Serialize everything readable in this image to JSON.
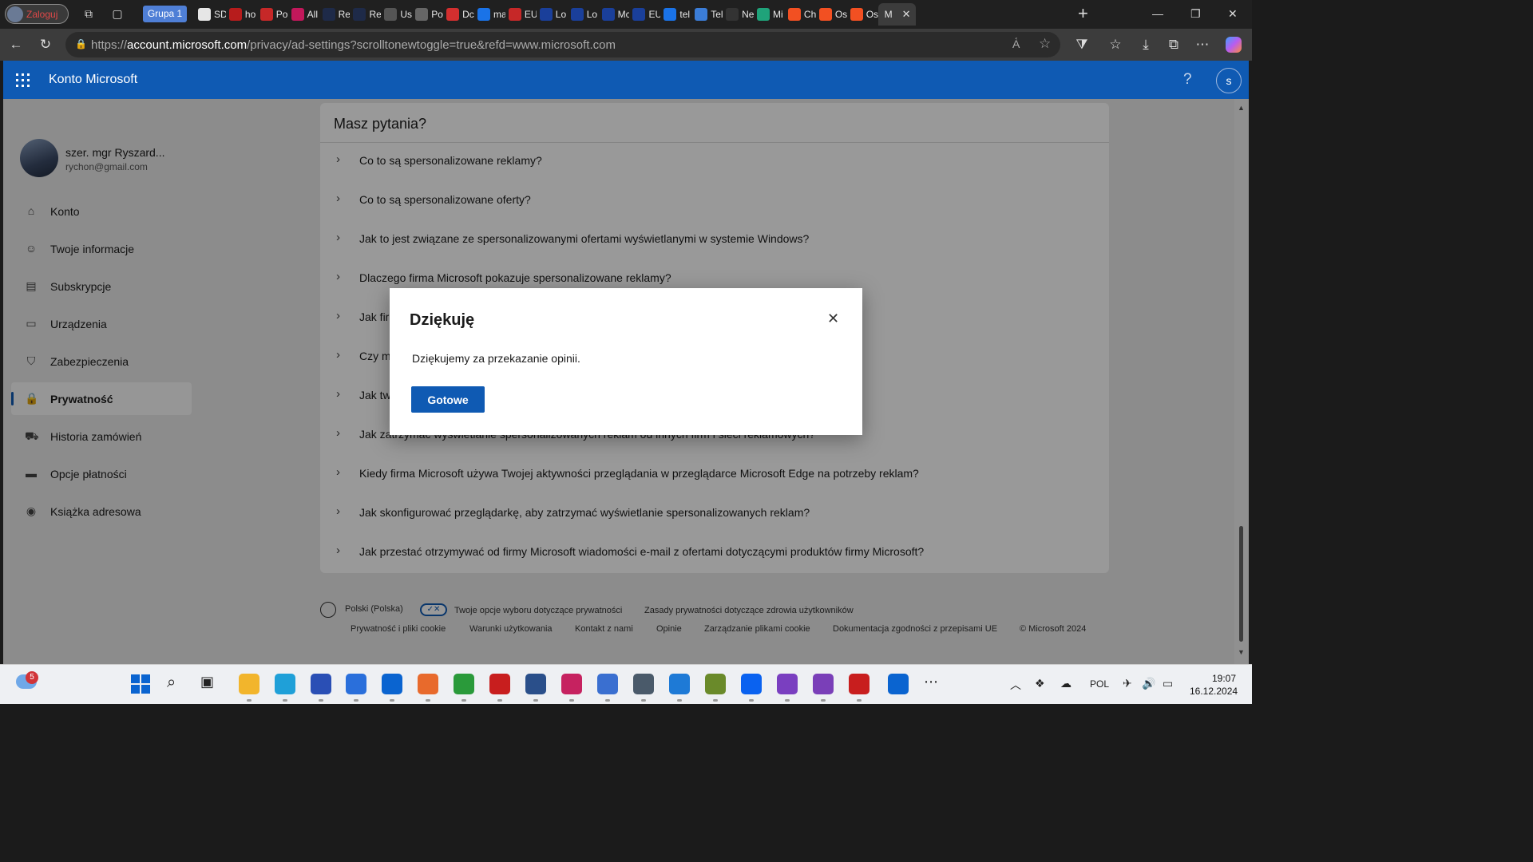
{
  "browser": {
    "profile_label": "Zaloguj",
    "group_label": "Grupa 1",
    "tabs": [
      {
        "title": "SD",
        "color": "#e6e6e6"
      },
      {
        "title": "ho",
        "color": "#b71c1c"
      },
      {
        "title": "Po",
        "color": "#c62828"
      },
      {
        "title": "All",
        "color": "#c2185b"
      },
      {
        "title": "Re",
        "color": "#1e2a48"
      },
      {
        "title": "Re",
        "color": "#1e2a48"
      },
      {
        "title": "Us",
        "color": "#555555"
      },
      {
        "title": "Po",
        "color": "#666666"
      },
      {
        "title": "Dc",
        "color": "#d32f2f"
      },
      {
        "title": "ma",
        "color": "#1a73e8"
      },
      {
        "title": "EU",
        "color": "#c62828"
      },
      {
        "title": "Lo",
        "color": "#1a3f9a"
      },
      {
        "title": "Lo",
        "color": "#1a3f9a"
      },
      {
        "title": "Mc",
        "color": "#1a3f9a"
      },
      {
        "title": "EU",
        "color": "#1a3f9a"
      },
      {
        "title": "tel",
        "color": "#1a73e8"
      },
      {
        "title": "Tel",
        "color": "#3b7dd8"
      },
      {
        "title": "Ne",
        "color": "#333333"
      },
      {
        "title": "Mi",
        "color": "#1fa37a"
      },
      {
        "title": "Ch",
        "color": "#f25022"
      },
      {
        "title": "Os",
        "color": "#f25022"
      },
      {
        "title": "Os",
        "color": "#f25022"
      }
    ],
    "active_tab_title": "M",
    "url_prefix": "https://",
    "url_host": "account.microsoft.com",
    "url_path": "/privacy/ad-settings?scrolltonewtoggle=true&refd=www.microsoft.com"
  },
  "app": {
    "title": "Konto Microsoft",
    "avatar_letter": "s",
    "help_icon": "question-icon"
  },
  "user": {
    "name": "szer. mgr Ryszard...",
    "email": "rychon@gmail.com"
  },
  "sidebar": {
    "items": [
      {
        "label": "Konto",
        "icon": "home-icon",
        "glyph": "⌂"
      },
      {
        "label": "Twoje informacje",
        "icon": "person-icon",
        "glyph": "☺"
      },
      {
        "label": "Subskrypcje",
        "icon": "subscription-icon",
        "glyph": "▤"
      },
      {
        "label": "Urządzenia",
        "icon": "monitor-icon",
        "glyph": "▭"
      },
      {
        "label": "Zabezpieczenia",
        "icon": "shield-icon",
        "glyph": "⛉"
      },
      {
        "label": "Prywatność",
        "icon": "lock-icon",
        "glyph": "🔒"
      },
      {
        "label": "Historia zamówień",
        "icon": "cart-icon",
        "glyph": "⛟"
      },
      {
        "label": "Opcje płatności",
        "icon": "card-icon",
        "glyph": "▬"
      },
      {
        "label": "Książka adresowa",
        "icon": "location-icon",
        "glyph": "◉"
      }
    ],
    "selected_index": 5
  },
  "faq": {
    "heading": "Masz pytania?",
    "questions": [
      "Co to są spersonalizowane reklamy?",
      "Co to są spersonalizowane oferty?",
      "Jak to jest związane ze spersonalizowanymi ofertami wyświetlanymi w systemie Windows?",
      "Dlaczego firma Microsoft pokazuje spersonalizowane reklamy?",
      "Jak fir",
      "Czy m",
      "Jak tw",
      "Jak zatrzymać wyświetlanie spersonalizowanych reklam od innych firm i sieci reklamowych?",
      "Kiedy firma Microsoft używa Twojej aktywności przeglądania w przeglądarce Microsoft Edge na potrzeby reklam?",
      "Jak skonfigurować przeglądarkę, aby zatrzymać wyświetlanie spersonalizowanych reklam?",
      "Jak przestać otrzymywać od firmy Microsoft wiadomości e-mail z ofertami dotyczącymi produktów firmy Microsoft?"
    ]
  },
  "footer": {
    "language": "Polski (Polska)",
    "privacy_choices": "Twoje opcje wyboru dotyczące prywatności",
    "health_privacy": "Zasady prywatności dotyczące zdrowia użytkowników",
    "links": [
      "Prywatność i pliki cookie",
      "Warunki użytkowania",
      "Kontakt z nami",
      "Opinie",
      "Zarządzanie plikami cookie",
      "Dokumentacja zgodności z przepisami UE",
      "© Microsoft 2024"
    ]
  },
  "dialog": {
    "title": "Dziękuję",
    "body": "Dziękujemy za przekazanie opinii.",
    "button": "Gotowe"
  },
  "taskbar": {
    "weather_badge": "5",
    "language": "POL",
    "time": "19:07",
    "date": "16.12.2024",
    "apps": [
      {
        "name": "start-icon",
        "color": "#0a64d0"
      },
      {
        "name": "search-icon",
        "color": "#333333"
      },
      {
        "name": "task-view-icon",
        "color": "#333333"
      },
      {
        "name": "file-explorer-icon",
        "color": "#f2b52c"
      },
      {
        "name": "edge-icon",
        "color": "#1fa0d8"
      },
      {
        "name": "save-app-icon",
        "color": "#2a4fb5"
      },
      {
        "name": "store-icon",
        "color": "#2a6fdb"
      },
      {
        "name": "outlook-icon",
        "color": "#0a64d0"
      },
      {
        "name": "git-app-icon",
        "color": "#e86a2c"
      },
      {
        "name": "xbox-icon",
        "color": "#2a9a3a"
      },
      {
        "name": "acrobat-icon",
        "color": "#c81e1e"
      },
      {
        "name": "virtualbox-icon",
        "color": "#2a4f8a"
      },
      {
        "name": "paint-app-icon",
        "color": "#c62260"
      },
      {
        "name": "network-app-icon",
        "color": "#3a6fd0"
      },
      {
        "name": "settings-icon",
        "color": "#4a5a6a"
      },
      {
        "name": "vscode-icon",
        "color": "#1e7ad6"
      },
      {
        "name": "tools-app-icon",
        "color": "#6a8a2a"
      },
      {
        "name": "dropbox-icon",
        "color": "#0a62f0"
      },
      {
        "name": "tor-icon",
        "color": "#7a3fc0"
      },
      {
        "name": "github-desktop-icon",
        "color": "#7a3fb8"
      },
      {
        "name": "rad-icon",
        "color": "#c81e1e"
      },
      {
        "name": "defender-icon",
        "color": "#0a64d0"
      },
      {
        "name": "more-icon",
        "color": "#333333"
      }
    ]
  }
}
